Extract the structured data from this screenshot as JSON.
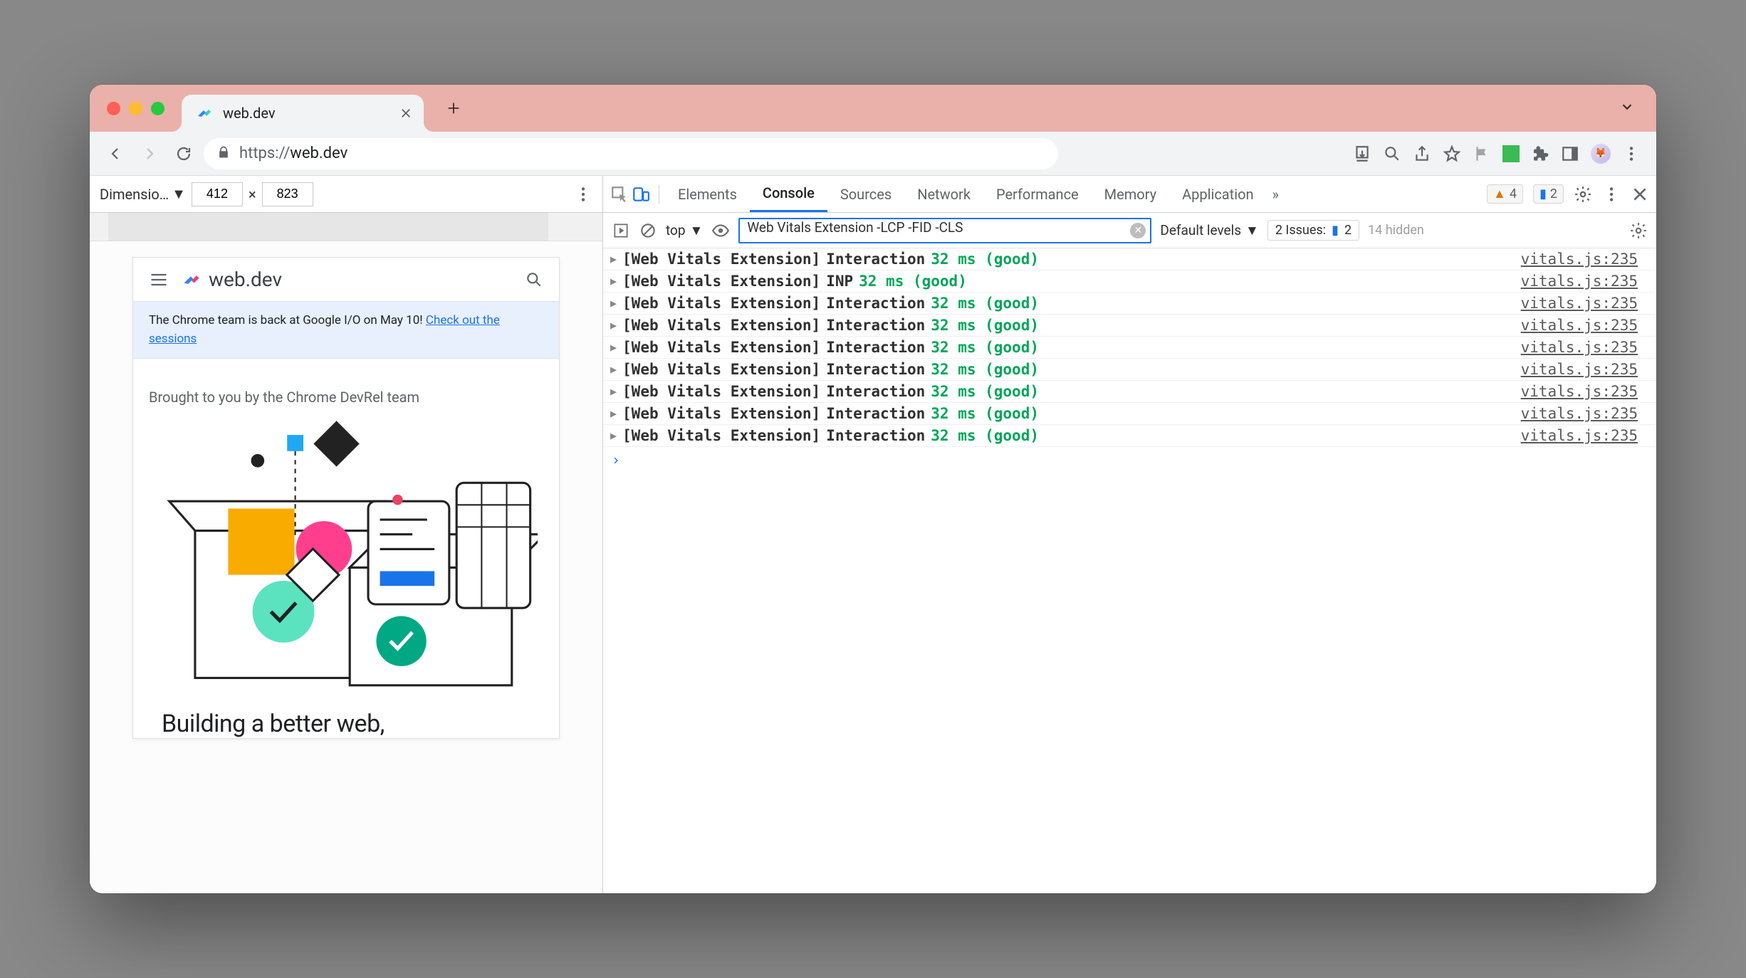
{
  "browser": {
    "tab_title": "web.dev",
    "url_proto": "https://",
    "url_rest": "web.dev"
  },
  "device_toolbar": {
    "label": "Dimensio…",
    "width": "412",
    "sep": "×",
    "height": "823"
  },
  "site": {
    "logo_text": "web.dev",
    "banner_text": "The Chrome team is back at Google I/O on May 10! ",
    "banner_link": "Check out the sessions",
    "subhead": "Brought to you by the Chrome DevRel team",
    "hero": "Building a better web,"
  },
  "devtools": {
    "tabs": [
      "Elements",
      "Console",
      "Sources",
      "Network",
      "Performance",
      "Memory",
      "Application"
    ],
    "active_tab": "Console",
    "more_tabs_glyph": "»",
    "warn_count": "4",
    "msg_count": "2"
  },
  "console_toolbar": {
    "context": "top",
    "filter": "Web Vitals Extension -LCP -FID -CLS",
    "levels": "Default levels",
    "issues_label": "2 Issues:",
    "issues_count": "2",
    "hidden": "14 hidden"
  },
  "console_rows": [
    {
      "label": "[Web Vitals Extension]",
      "metric": "Interaction",
      "value": "32 ms (good)",
      "src": "vitals.js:235"
    },
    {
      "label": "[Web Vitals Extension]",
      "metric": "INP",
      "value": "32 ms (good)",
      "src": "vitals.js:235"
    },
    {
      "label": "[Web Vitals Extension]",
      "metric": "Interaction",
      "value": "32 ms (good)",
      "src": "vitals.js:235"
    },
    {
      "label": "[Web Vitals Extension]",
      "metric": "Interaction",
      "value": "32 ms (good)",
      "src": "vitals.js:235"
    },
    {
      "label": "[Web Vitals Extension]",
      "metric": "Interaction",
      "value": "32 ms (good)",
      "src": "vitals.js:235"
    },
    {
      "label": "[Web Vitals Extension]",
      "metric": "Interaction",
      "value": "32 ms (good)",
      "src": "vitals.js:235"
    },
    {
      "label": "[Web Vitals Extension]",
      "metric": "Interaction",
      "value": "32 ms (good)",
      "src": "vitals.js:235"
    },
    {
      "label": "[Web Vitals Extension]",
      "metric": "Interaction",
      "value": "32 ms (good)",
      "src": "vitals.js:235"
    },
    {
      "label": "[Web Vitals Extension]",
      "metric": "Interaction",
      "value": "32 ms (good)",
      "src": "vitals.js:235"
    }
  ]
}
